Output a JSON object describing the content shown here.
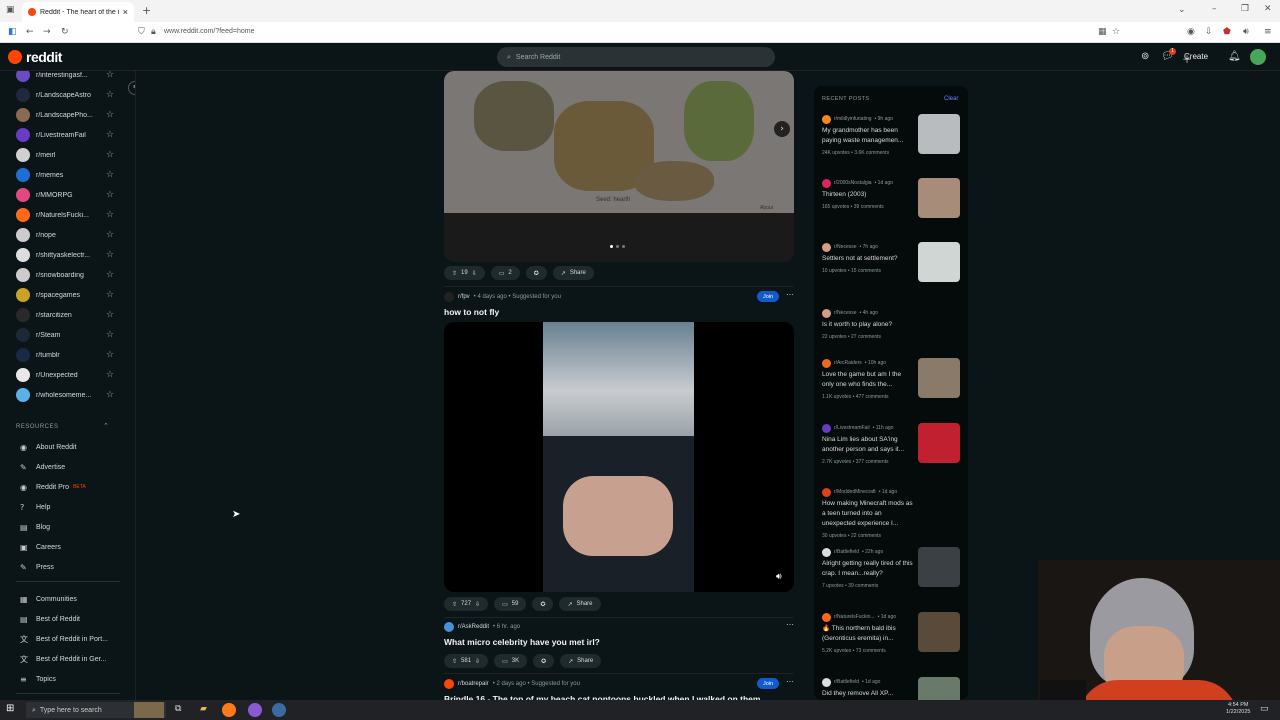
{
  "browser": {
    "tab_title": "Reddit - The heart of the in",
    "url": "www.reddit.com/?feed=home",
    "new_tab": "+",
    "close_tab": "×"
  },
  "header": {
    "logo": "reddit",
    "search_placeholder": "Search Reddit",
    "create_label": "Create",
    "notif_badge": "1"
  },
  "sidebar": {
    "subs": [
      {
        "name": "r/interestingasf...",
        "color": "#6a4bc4"
      },
      {
        "name": "r/LandscapeAstro",
        "color": "#1e2a3c"
      },
      {
        "name": "r/LandscapePho...",
        "color": "#8a6a50"
      },
      {
        "name": "r/LivestreamFail",
        "color": "#6a3bc4"
      },
      {
        "name": "r/meirl",
        "color": "#d0d0d0"
      },
      {
        "name": "r/memes",
        "color": "#1d6fd4"
      },
      {
        "name": "r/MMORPG",
        "color": "#e04880"
      },
      {
        "name": "r/NaturelsFucki...",
        "color": "#ff6a1a"
      },
      {
        "name": "r/nope",
        "color": "#cccccc"
      },
      {
        "name": "r/shittyaskelectr...",
        "color": "#dddddd"
      },
      {
        "name": "r/snowboarding",
        "color": "#cccccc"
      },
      {
        "name": "r/spacegames",
        "color": "#c9a227"
      },
      {
        "name": "r/starcitizen",
        "color": "#2a2a2a"
      },
      {
        "name": "r/Steam",
        "color": "#1b2838"
      },
      {
        "name": "r/tumblr",
        "color": "#1a2a44"
      },
      {
        "name": "r/Unexpected",
        "color": "#e8e8e8"
      },
      {
        "name": "r/wholesomeme...",
        "color": "#5ab0e8"
      }
    ],
    "resources_heading": "RESOURCES",
    "resources": [
      {
        "label": "About Reddit",
        "icon": "◉"
      },
      {
        "label": "Advertise",
        "icon": "✎"
      },
      {
        "label": "Reddit Pro",
        "icon": "◉",
        "badge": "BETA"
      },
      {
        "label": "Help",
        "icon": "?"
      },
      {
        "label": "Blog",
        "icon": "▤"
      },
      {
        "label": "Careers",
        "icon": "▣"
      },
      {
        "label": "Press",
        "icon": "✎"
      }
    ],
    "more": [
      {
        "label": "Communities",
        "icon": "▦"
      },
      {
        "label": "Best of Reddit",
        "icon": "▤"
      },
      {
        "label": "Best of Reddit in Port...",
        "icon": "文"
      },
      {
        "label": "Best of Reddit in Ger...",
        "icon": "文"
      },
      {
        "label": "Topics",
        "icon": "≡"
      }
    ]
  },
  "feed": {
    "post1": {
      "map_caption": "Seed: hearth",
      "map_about": "About",
      "upvotes": "19",
      "comments": "2",
      "share": "Share"
    },
    "post2": {
      "subreddit": "r/fpv",
      "meta": "• 4 days ago • Suggested for you",
      "title": "how to not fly",
      "join": "Join",
      "upvotes": "727",
      "comments": "59",
      "share": "Share"
    },
    "post3": {
      "subreddit": "r/AskReddit",
      "meta": "• 6 hr. ago",
      "title": "What micro celebrity have you met irl?",
      "upvotes": "581",
      "comments": "3K",
      "share": "Share"
    },
    "post4": {
      "subreddit": "r/boatrepair",
      "meta": "• 2 days ago • Suggested for you",
      "title": "Brindle 16 - The top of my beach cat pontoons buckled when I walked on them",
      "join": "Join"
    }
  },
  "recent": {
    "heading": "RECENT POSTS",
    "clear": "Clear",
    "posts": [
      {
        "sub": "r/mildlyinfuriating",
        "age": "• 9h ago",
        "title": "My grandmother has been paying waste managemen...",
        "stats": "24K upvotes • 3.6K comments",
        "thumb": "#b9bcbe",
        "av": "#ff8717"
      },
      {
        "sub": "r/2000sNostalgia",
        "age": "• 1d ago",
        "title": "Thirteen (2003)",
        "stats": "165 upvotes • 39 comments",
        "thumb": "#a88c7a",
        "av": "#e0245e"
      },
      {
        "sub": "r/Necesse",
        "age": "• 7h ago",
        "title": "Settlers not at settlement?",
        "stats": "10 upvotes • 15 comments",
        "thumb": "#cfd6d4",
        "av": "#d49a8a"
      },
      {
        "sub": "r/Necesse",
        "age": "• 4h ago",
        "title": "Is it worth to play alone?",
        "stats": "22 upvotes • 27 comments",
        "thumb": "",
        "av": "#d49a8a"
      },
      {
        "sub": "r/ArcRaiders",
        "age": "• 10h ago",
        "title": "Love the game but am I the only one who finds the...",
        "stats": "1.1K upvotes • 477 comments",
        "thumb": "#8a7a6a",
        "av": "#f06a1a"
      },
      {
        "sub": "r/LivestreamFail",
        "age": "• 11h ago",
        "title": "Nina Lim lies about SA'ing another person and says it...",
        "stats": "2.7K upvotes • 377 comments",
        "thumb": "#c02030",
        "av": "#6a3bc4"
      },
      {
        "sub": "r/ModdedMinecraft",
        "age": "• 1d ago",
        "title": "How making Minecraft mods as a teen turned into an unexpected experience I...",
        "stats": "30 upvotes • 22 comments",
        "thumb": "",
        "av": "#e0401a"
      },
      {
        "sub": "r/Battlefield",
        "age": "• 22h ago",
        "title": "Alright getting really tired of this crap. I mean...really?",
        "stats": "7 upvotes • 39 comments",
        "thumb": "#3a4044",
        "av": "#dddddd"
      },
      {
        "sub": "r/NaturelsFuckin...",
        "age": "• 1d ago",
        "title": "🔥 This northern bald ibis (Geronticus eremita) in...",
        "stats": "5.2K upvotes • 73 comments",
        "thumb": "#5a4a3a",
        "av": "#ff6a1a"
      },
      {
        "sub": "r/Battlefield",
        "age": "• 1d ago",
        "title": "Did they remove All XP...",
        "stats": "",
        "thumb": "#6a7a6a",
        "av": "#dddddd"
      }
    ]
  },
  "taskbar": {
    "search": "Type here to search",
    "time": "4:54 PM",
    "date": "1/22/2025"
  }
}
